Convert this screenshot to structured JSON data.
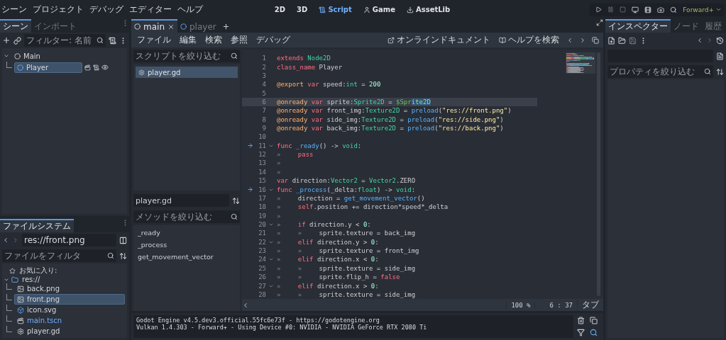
{
  "menu": [
    "シーン",
    "プロジェクト",
    "デバッグ",
    "エディター",
    "ヘルプ"
  ],
  "workspaces": [
    {
      "label": "2D",
      "kind": "canvas",
      "selected": false
    },
    {
      "label": "3D",
      "kind": "spatial",
      "selected": false
    },
    {
      "label": "Script",
      "kind": "script",
      "selected": true
    },
    {
      "label": "Game",
      "kind": "game",
      "selected": false
    },
    {
      "label": "AssetLib",
      "kind": "assetlib",
      "selected": false
    }
  ],
  "renderer": "Forward+",
  "scene_dock": {
    "tabs": [
      {
        "label": "シーン",
        "selected": true
      },
      {
        "label": "インポート",
        "selected": false
      }
    ],
    "filter_placeholder": "フィルター: 名前",
    "tree": [
      {
        "name": "Main",
        "expanded": true,
        "selected": false,
        "children": [
          {
            "name": "Player",
            "selected": true
          }
        ]
      }
    ]
  },
  "filesystem": {
    "tabs": [
      {
        "label": "ファイルシステム",
        "selected": true
      }
    ],
    "path": "res://front.png",
    "filter_placeholder": "ファイルをフィルタ",
    "favorites": "お気に入り:",
    "root": {
      "name": "res://",
      "expanded": true,
      "children": [
        {
          "name": "back.png",
          "kind": "image",
          "selected": false,
          "opened": false
        },
        {
          "name": "front.png",
          "kind": "image",
          "selected": true,
          "opened": false
        },
        {
          "name": "icon.svg",
          "kind": "svg",
          "selected": false,
          "opened": false
        },
        {
          "name": "main.tscn",
          "kind": "scene",
          "selected": false,
          "opened": true
        },
        {
          "name": "player.gd",
          "kind": "script",
          "selected": false,
          "opened": false
        }
      ]
    }
  },
  "editor_tabs": [
    {
      "label": "main",
      "selected": true
    },
    {
      "label": "player",
      "selected": false
    }
  ],
  "script_menu": [
    "ファイル",
    "編集",
    "検索",
    "参照",
    "デバッグ"
  ],
  "doc_links": [
    {
      "label": "オンラインドキュメント",
      "kind": "online"
    },
    {
      "label": "ヘルプを検索",
      "kind": "help"
    }
  ],
  "script_filter_placeholder": "スクリプトを絞り込む",
  "scripts": [
    {
      "name": "player.gd",
      "selected": true
    }
  ],
  "current_script": "player.gd",
  "method_filter_placeholder": "メソッドを絞り込む",
  "methods": [
    "_ready",
    "_process",
    "get_movement_vector"
  ],
  "code": [
    {
      "number": "1",
      "current": false,
      "foldable": false,
      "override": false,
      "tokens": [
        {
          "text": "extends",
          "kind": "kw"
        },
        {
          "text": " Node2D",
          "kind": "type"
        }
      ]
    },
    {
      "number": "2",
      "current": false,
      "foldable": false,
      "override": false,
      "tokens": [
        {
          "text": "class_name",
          "kind": "kw"
        },
        {
          "text": " Player",
          "kind": "plain"
        }
      ]
    },
    {
      "number": "3",
      "current": false,
      "foldable": false,
      "override": false
    },
    {
      "number": "4",
      "current": false,
      "foldable": false,
      "override": false,
      "tokens": [
        {
          "text": "@export",
          "kind": "annot"
        },
        {
          "text": " var",
          "kind": "kw"
        },
        {
          "text": " speed:",
          "kind": "plain"
        },
        {
          "text": "int",
          "kind": "type"
        },
        {
          "text": " = ",
          "kind": "plain"
        },
        {
          "text": "200",
          "kind": "num"
        }
      ]
    },
    {
      "number": "5",
      "current": false,
      "foldable": false,
      "override": false
    },
    {
      "number": "6",
      "current": true,
      "foldable": false,
      "override": false,
      "tokens": [
        {
          "text": "@onready",
          "kind": "annot"
        },
        {
          "text": " var",
          "kind": "kw"
        },
        {
          "text": " sprite:",
          "kind": "plain"
        },
        {
          "text": "Sprite2D",
          "kind": "type"
        },
        {
          "text": " = ",
          "kind": "plain"
        },
        {
          "text": "$Spr",
          "kind": "path"
        },
        {
          "text": "ite2D",
          "kind": "sel"
        }
      ]
    },
    {
      "number": "7",
      "current": false,
      "foldable": false,
      "override": false,
      "tokens": [
        {
          "text": "@onready",
          "kind": "annot"
        },
        {
          "text": " var",
          "kind": "kw"
        },
        {
          "text": " front_img:",
          "kind": "plain"
        },
        {
          "text": "Texture2D",
          "kind": "type"
        },
        {
          "text": " = ",
          "kind": "plain"
        },
        {
          "text": "preload",
          "kind": "func"
        },
        {
          "text": "(",
          "kind": "plain"
        },
        {
          "text": "\"res://front.png\"",
          "kind": "str"
        },
        {
          "text": ")",
          "kind": "plain"
        }
      ]
    },
    {
      "number": "8",
      "current": false,
      "foldable": false,
      "override": false,
      "tokens": [
        {
          "text": "@onready",
          "kind": "annot"
        },
        {
          "text": " var",
          "kind": "kw"
        },
        {
          "text": " side_img:",
          "kind": "plain"
        },
        {
          "text": "Texture2D",
          "kind": "type"
        },
        {
          "text": " = ",
          "kind": "plain"
        },
        {
          "text": "preload",
          "kind": "func"
        },
        {
          "text": "(",
          "kind": "plain"
        },
        {
          "text": "\"res://side.png\"",
          "kind": "str"
        },
        {
          "text": ")",
          "kind": "plain"
        }
      ]
    },
    {
      "number": "9",
      "current": false,
      "foldable": false,
      "override": false,
      "tokens": [
        {
          "text": "@onready",
          "kind": "annot"
        },
        {
          "text": " var",
          "kind": "kw"
        },
        {
          "text": " back_img:",
          "kind": "plain"
        },
        {
          "text": "Texture2D",
          "kind": "type"
        },
        {
          "text": " = ",
          "kind": "plain"
        },
        {
          "text": "preload",
          "kind": "func"
        },
        {
          "text": "(",
          "kind": "plain"
        },
        {
          "text": "\"res://back.png\"",
          "kind": "str"
        },
        {
          "text": ")",
          "kind": "plain"
        }
      ]
    },
    {
      "number": "10",
      "current": false,
      "foldable": false,
      "override": false
    },
    {
      "number": "11",
      "current": false,
      "foldable": true,
      "override": true,
      "tokens": [
        {
          "text": "func",
          "kind": "kw"
        },
        {
          "text": " _ready",
          "kind": "func"
        },
        {
          "text": "() -> ",
          "kind": "plain"
        },
        {
          "text": "void",
          "kind": "type"
        },
        {
          "text": ":",
          "kind": "plain"
        }
      ]
    },
    {
      "number": "12",
      "current": false,
      "foldable": false,
      "override": false,
      "tokens": [
        {
          "text": "»",
          "kind": "tab"
        },
        {
          "text": "pass",
          "kind": "kw"
        }
      ]
    },
    {
      "number": "13",
      "current": false,
      "foldable": false,
      "override": false,
      "tokens": [
        {
          "text": "»",
          "kind": "tab"
        }
      ]
    },
    {
      "number": "14",
      "current": false,
      "foldable": false,
      "override": false,
      "tokens": [
        {
          "text": "»",
          "kind": "tab"
        }
      ]
    },
    {
      "number": "15",
      "current": false,
      "foldable": false,
      "override": false,
      "tokens": [
        {
          "text": "var",
          "kind": "kw"
        },
        {
          "text": " direction:",
          "kind": "plain"
        },
        {
          "text": "Vector2",
          "kind": "type"
        },
        {
          "text": " = ",
          "kind": "plain"
        },
        {
          "text": "Vector2",
          "kind": "type"
        },
        {
          "text": ".ZERO",
          "kind": "plain"
        }
      ]
    },
    {
      "number": "16",
      "current": false,
      "foldable": true,
      "override": true,
      "tokens": [
        {
          "text": "func",
          "kind": "kw"
        },
        {
          "text": " _process",
          "kind": "func"
        },
        {
          "text": "(_delta:",
          "kind": "plain"
        },
        {
          "text": "float",
          "kind": "type"
        },
        {
          "text": ") -> ",
          "kind": "plain"
        },
        {
          "text": "void",
          "kind": "type"
        },
        {
          "text": ":",
          "kind": "plain"
        }
      ]
    },
    {
      "number": "17",
      "current": false,
      "foldable": false,
      "override": false,
      "tokens": [
        {
          "text": "»",
          "kind": "tab"
        },
        {
          "text": "direction = ",
          "kind": "plain"
        },
        {
          "text": "get_movement_vector",
          "kind": "func"
        },
        {
          "text": "()",
          "kind": "plain"
        }
      ]
    },
    {
      "number": "18",
      "current": false,
      "foldable": false,
      "override": false,
      "tokens": [
        {
          "text": "»",
          "kind": "tab"
        },
        {
          "text": "self",
          "kind": "kw"
        },
        {
          "text": ".position += direction*speed*_delta",
          "kind": "plain"
        }
      ]
    },
    {
      "number": "19",
      "current": false,
      "foldable": false,
      "override": false,
      "tokens": [
        {
          "text": "»",
          "kind": "tab"
        }
      ]
    },
    {
      "number": "20",
      "current": false,
      "foldable": true,
      "override": false,
      "tokens": [
        {
          "text": "»",
          "kind": "tab"
        },
        {
          "text": "if",
          "kind": "kw"
        },
        {
          "text": " direction.y < ",
          "kind": "plain"
        },
        {
          "text": "0",
          "kind": "num"
        },
        {
          "text": ":",
          "kind": "plain"
        }
      ]
    },
    {
      "number": "21",
      "current": false,
      "foldable": false,
      "override": false,
      "tokens": [
        {
          "text": "»",
          "kind": "tab"
        },
        {
          "text": "»",
          "kind": "tab"
        },
        {
          "text": "sprite.texture = back_img",
          "kind": "plain"
        }
      ]
    },
    {
      "number": "22",
      "current": false,
      "foldable": true,
      "override": false,
      "tokens": [
        {
          "text": "»",
          "kind": "tab"
        },
        {
          "text": "elif",
          "kind": "kw"
        },
        {
          "text": " direction.y > ",
          "kind": "plain"
        },
        {
          "text": "0",
          "kind": "num"
        },
        {
          "text": ":",
          "kind": "plain"
        }
      ]
    },
    {
      "number": "23",
      "current": false,
      "foldable": false,
      "override": false,
      "tokens": [
        {
          "text": "»",
          "kind": "tab"
        },
        {
          "text": "»",
          "kind": "tab"
        },
        {
          "text": "sprite.texture = front_img",
          "kind": "plain"
        }
      ]
    },
    {
      "number": "24",
      "current": false,
      "foldable": true,
      "override": false,
      "tokens": [
        {
          "text": "»",
          "kind": "tab"
        },
        {
          "text": "elif",
          "kind": "kw"
        },
        {
          "text": " direction.x < ",
          "kind": "plain"
        },
        {
          "text": "0",
          "kind": "num"
        },
        {
          "text": ":",
          "kind": "plain"
        }
      ]
    },
    {
      "number": "25",
      "current": false,
      "foldable": false,
      "override": false,
      "tokens": [
        {
          "text": "»",
          "kind": "tab"
        },
        {
          "text": "»",
          "kind": "tab"
        },
        {
          "text": "sprite.texture = side_img",
          "kind": "plain"
        }
      ]
    },
    {
      "number": "26",
      "current": false,
      "foldable": false,
      "override": false,
      "tokens": [
        {
          "text": "»",
          "kind": "tab"
        },
        {
          "text": "»",
          "kind": "tab"
        },
        {
          "text": "sprite.flip_h = ",
          "kind": "plain"
        },
        {
          "text": "false",
          "kind": "kw"
        }
      ]
    },
    {
      "number": "27",
      "current": false,
      "foldable": true,
      "override": false,
      "tokens": [
        {
          "text": "»",
          "kind": "tab"
        },
        {
          "text": "elif",
          "kind": "kw"
        },
        {
          "text": " direction.x > ",
          "kind": "plain"
        },
        {
          "text": "0",
          "kind": "num"
        },
        {
          "text": ":",
          "kind": "plain"
        }
      ]
    },
    {
      "number": "28",
      "current": false,
      "foldable": false,
      "override": false,
      "tokens": [
        {
          "text": "»",
          "kind": "tab"
        },
        {
          "text": "»",
          "kind": "tab"
        },
        {
          "text": "sprite.texture = side_img",
          "kind": "plain"
        }
      ]
    }
  ],
  "status": {
    "zoom": "100 %",
    "position": "6 : 37",
    "indent": "タブ"
  },
  "output": [
    "Godot Engine v4.5.dev3.official.55fc6e73f - https://godotengine.org",
    "Vulkan 1.4.303 - Forward+ - Using Device #0: NVIDIA - NVIDIA GeForce RTX 2080 Ti"
  ],
  "inspector": {
    "tabs": [
      {
        "label": "インスペクター",
        "selected": true
      },
      {
        "label": "ノード",
        "selected": false
      },
      {
        "label": "履歴",
        "selected": false
      }
    ],
    "filter_placeholder": "プロパティを絞り込む"
  }
}
